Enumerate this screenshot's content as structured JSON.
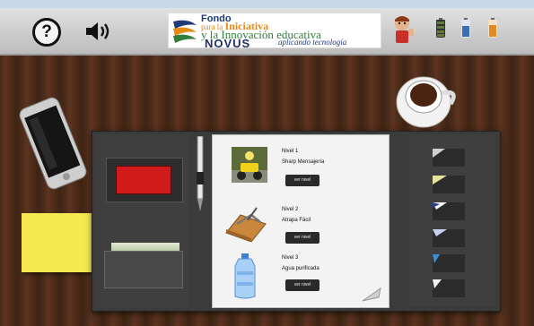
{
  "toolbar": {
    "help_glyph": "?",
    "logo": {
      "line1": "Fondo",
      "line2a": "para la",
      "line2b": "Iniciativa",
      "line3": "y la Innovación educativa",
      "line4": "NOVUS",
      "line5": "aplicando tecnología"
    }
  },
  "levels": [
    {
      "title": "Nivel 1",
      "name": "Sharp Mensajería",
      "button": "ver nivel",
      "icon": "courier-scooter-icon"
    },
    {
      "title": "Nivel 2",
      "name": "Atrapa Fácil",
      "button": "ver nivel",
      "icon": "mousetrap-icon"
    },
    {
      "title": "Nivel 3",
      "name": "Agua purificada",
      "button": "ver nivel",
      "icon": "water-jug-icon"
    }
  ],
  "colors": {
    "battery_green": "#5f7a3b",
    "battery_blue": "#3b6fb5",
    "battery_orange": "#e08a22",
    "red_card": "#d11a1a",
    "sticky_note": "#f4ea4f"
  }
}
